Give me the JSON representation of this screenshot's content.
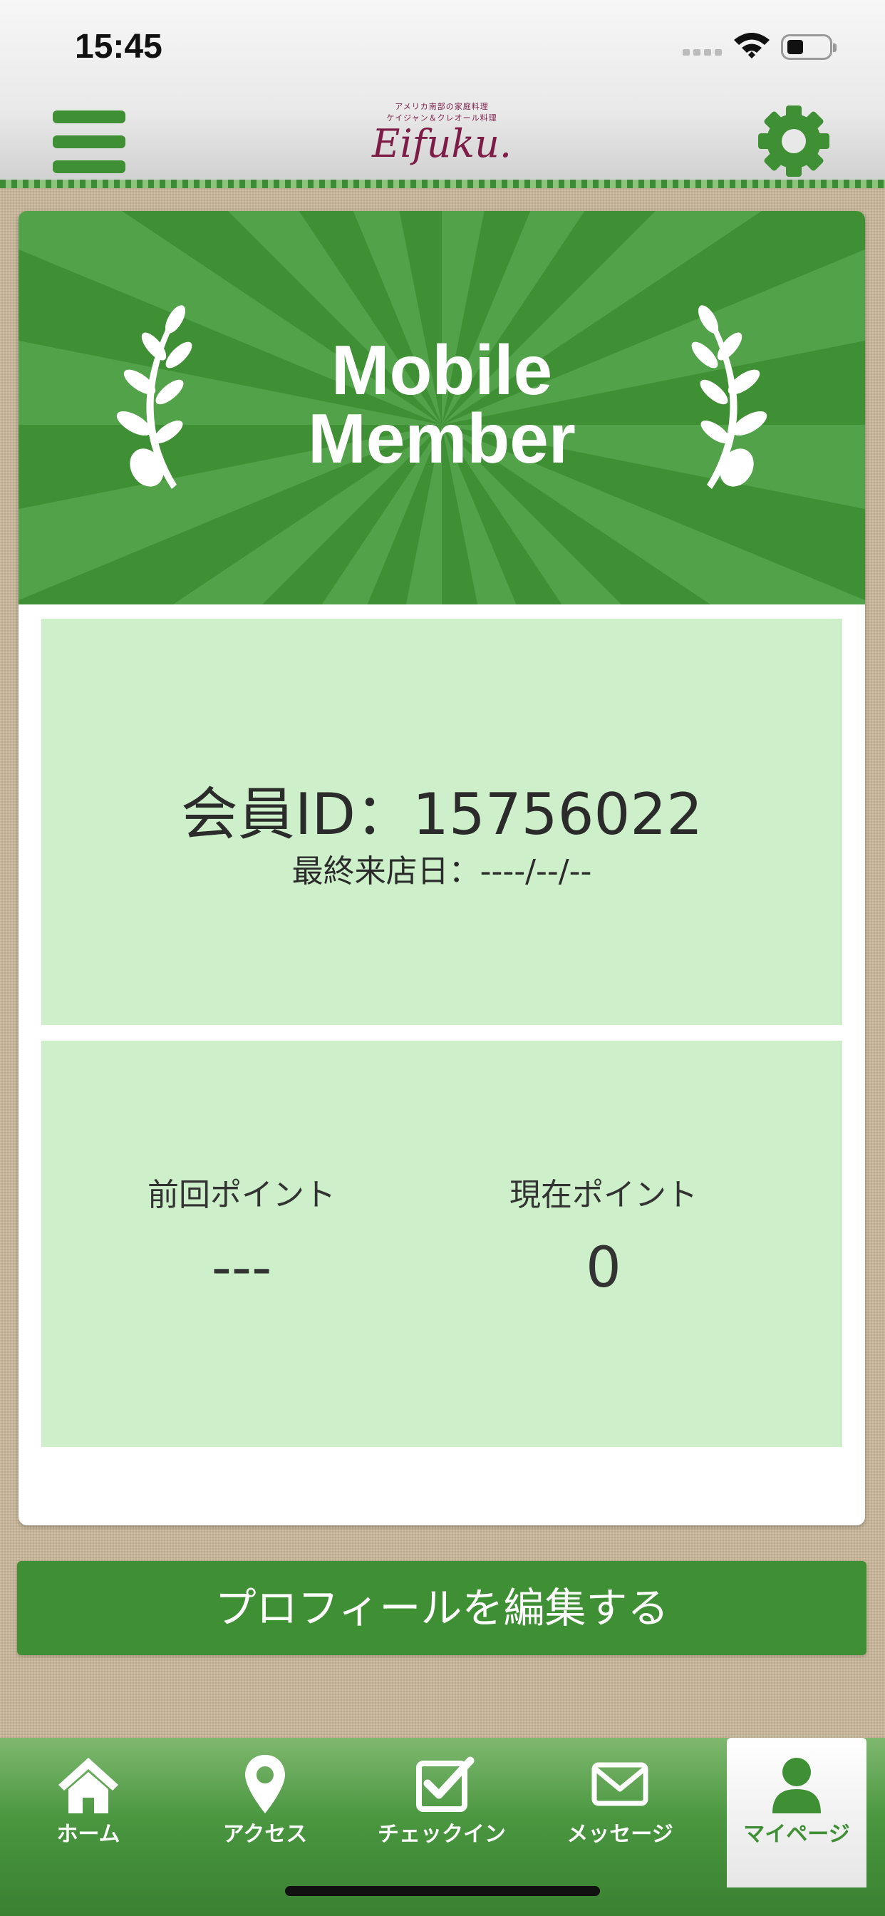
{
  "status_bar": {
    "time": "15:45"
  },
  "header": {
    "logo_tagline_1": "アメリカ南部の家庭料理",
    "logo_tagline_2": "ケイジャン＆クレオール料理",
    "logo_text": "Eifuku."
  },
  "banner": {
    "title_line1": "Mobile",
    "title_line2": "Member"
  },
  "member": {
    "id_text": "会員ID：15756022",
    "last_visit_text": "最終来店日：----/--/--"
  },
  "points": {
    "previous_label": "前回ポイント",
    "previous_value": "---",
    "current_label": "現在ポイント",
    "current_value": "0"
  },
  "edit_profile_label": "プロフィールを編集する",
  "tabs": [
    {
      "label": "ホーム",
      "icon": "home-icon"
    },
    {
      "label": "アクセス",
      "icon": "map-pin-icon"
    },
    {
      "label": "チェックイン",
      "icon": "checkin-icon"
    },
    {
      "label": "メッセージ",
      "icon": "message-icon"
    },
    {
      "label": "マイページ",
      "icon": "user-icon",
      "active": true
    }
  ],
  "colors": {
    "brand_green": "#3f8f34",
    "panel_green": "#cdefc9",
    "logo": "#7d1c47"
  }
}
